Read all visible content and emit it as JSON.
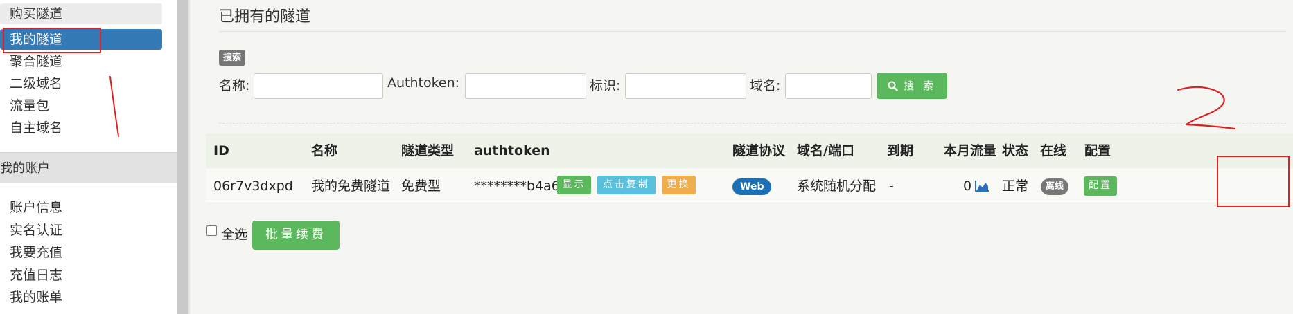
{
  "sidebar": {
    "items": [
      {
        "label": "购买隧道"
      },
      {
        "label": "我的隧道"
      },
      {
        "label": "聚合隧道"
      },
      {
        "label": "二级域名"
      },
      {
        "label": "流量包"
      },
      {
        "label": "自主域名"
      }
    ],
    "section_title": "我的账户",
    "account_items": [
      {
        "label": "账户信息"
      },
      {
        "label": "实名认证"
      },
      {
        "label": "我要充值"
      },
      {
        "label": "充值日志"
      },
      {
        "label": "我的账单"
      }
    ]
  },
  "main": {
    "title": "已拥有的隧道",
    "search": {
      "badge": "搜索",
      "name_label": "名称:",
      "authtoken_label": "Authtoken:",
      "tag_label": "标识:",
      "domain_label": "域名:",
      "button_label": "搜 索"
    },
    "table": {
      "headers": [
        "ID",
        "名称",
        "隧道类型",
        "authtoken",
        "隧道协议",
        "域名/端口",
        "到期",
        "本月流量",
        "状态",
        "在线",
        "配置"
      ],
      "rows": [
        {
          "id": "06r7v3dxpd",
          "name": "我的免费隧道",
          "type": "免费型",
          "authtoken": "********b4a6",
          "btn_show": "显示",
          "btn_copy": "点击复制",
          "btn_change": "更换",
          "protocol": "Web",
          "domain": "系统随机分配",
          "expire": "-",
          "traffic": "0",
          "status": "正常",
          "online": "离线",
          "config": "配置"
        }
      ]
    },
    "select_all": "全选",
    "batch_renew": "批量续费"
  },
  "annotation": {
    "number": "2"
  },
  "colors": {
    "primary": "#337ab7",
    "success": "#5cb85c",
    "info": "#5bc0de",
    "warning": "#f0ad4e",
    "annotation": "#e0201f"
  }
}
